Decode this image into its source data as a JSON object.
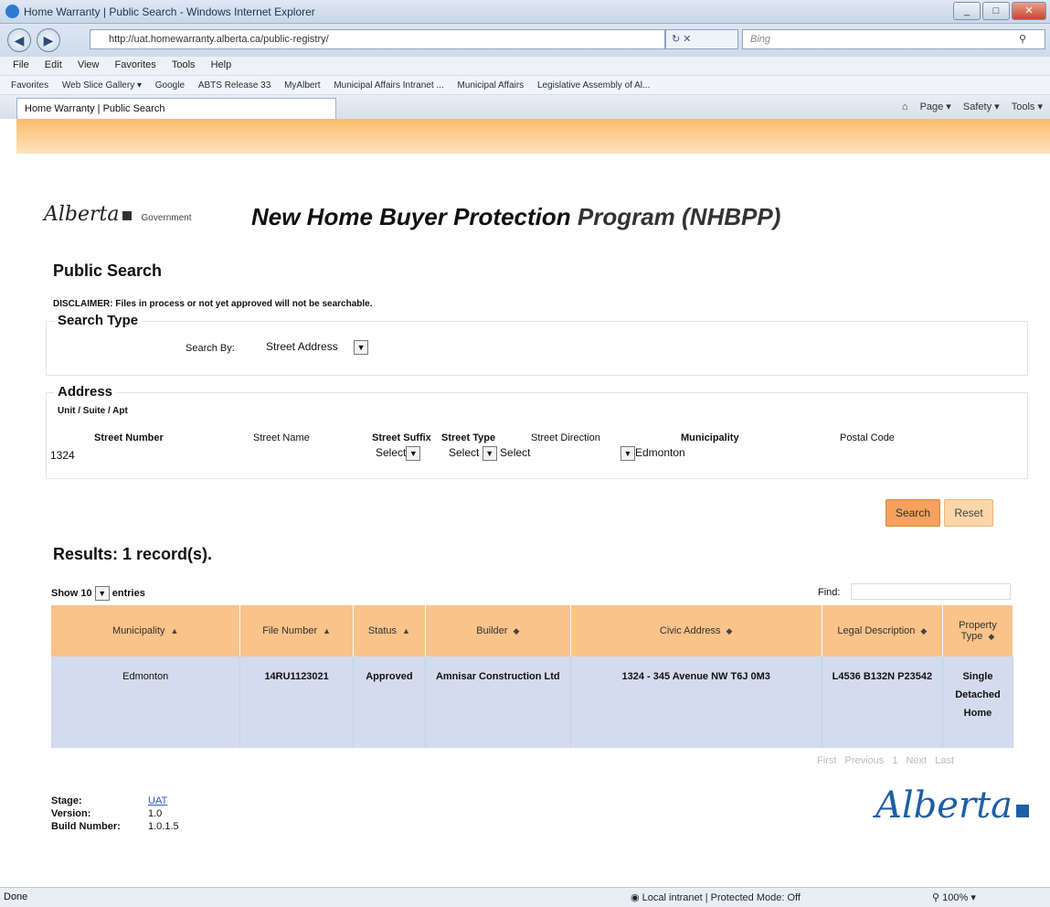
{
  "window": {
    "title": "Home Warranty | Public Search - Windows Internet Explorer",
    "url": "http://uat.homewarranty.alberta.ca/public-registry/",
    "search_placeholder": "Bing",
    "controls": {
      "minimize": "_",
      "maximize": "□",
      "close": "✕"
    }
  },
  "menubar": [
    "File",
    "Edit",
    "View",
    "Favorites",
    "Tools",
    "Help"
  ],
  "favorites_bar": [
    "Favorites",
    "Web Slice Gallery ▾",
    "Google",
    "ABTS Release 33",
    "MyAlbert",
    "Municipal Affairs Intranet ...",
    "Municipal Affairs",
    "Legislative Assembly of Al..."
  ],
  "tab": {
    "label": "Home Warranty | Public Search"
  },
  "command_bar": [
    "Page ▾",
    "Safety ▾",
    "Tools ▾"
  ],
  "header": {
    "logo_text": "Alberta",
    "logo_sub": "Government",
    "title_a": "New Home Buyer Protection",
    "title_b": "Program (NHBPP)"
  },
  "public_search": {
    "heading": "Public Search",
    "disclaimer": "DISCLAIMER:   Files in process or not yet approved will not be searchable."
  },
  "search_type": {
    "legend": "Search Type",
    "search_by_label": "Search By:",
    "search_by_value": "Street Address"
  },
  "address": {
    "legend": "Address",
    "unit_label": "Unit / Suite / Apt",
    "street_number_label": "Street Number",
    "street_number_value": "1324",
    "street_name_label": "Street Name",
    "street_suffix_label": "Street Suffix",
    "street_suffix_value": "Select",
    "street_type_label": "Street Type",
    "street_type_value": "Select",
    "street_direction_label": "Street Direction",
    "street_direction_value": "Select",
    "municipality_label": "Municipality",
    "municipality_value": "Edmonton",
    "postal_code_label": "Postal Code"
  },
  "buttons": {
    "search": "Search",
    "reset": "Reset"
  },
  "results": {
    "heading": "Results: 1 record(s).",
    "show_prefix": "Show",
    "show_value": "10",
    "show_suffix": "entries",
    "find_label": "Find:",
    "columns": [
      "Municipality",
      "File Number",
      "Status",
      "Builder",
      "Civic Address",
      "Legal Description",
      "Property Type"
    ],
    "rows": [
      {
        "municipality": "Edmonton",
        "file_number": "14RU1123021",
        "status": "Approved",
        "builder": "Amnisar Construction Ltd",
        "civic_address": "1324 - 345 Avenue NW T6J 0M3",
        "legal_description": "L4536 B132N P23542",
        "property_type": "Single Detached Home"
      }
    ],
    "pager": [
      "First",
      "Previous",
      "1",
      "Next",
      "Last"
    ]
  },
  "footer": {
    "stage_label": "Stage:",
    "stage_value": "UAT",
    "version_label": "Version:",
    "version_value": "1.0",
    "build_label": "Build Number:",
    "build_value": "1.0.1.5",
    "logo_text": "Alberta"
  },
  "statusbar": {
    "left": "Done",
    "zone": "Local intranet | Protected Mode: Off",
    "zoom": "100%"
  }
}
